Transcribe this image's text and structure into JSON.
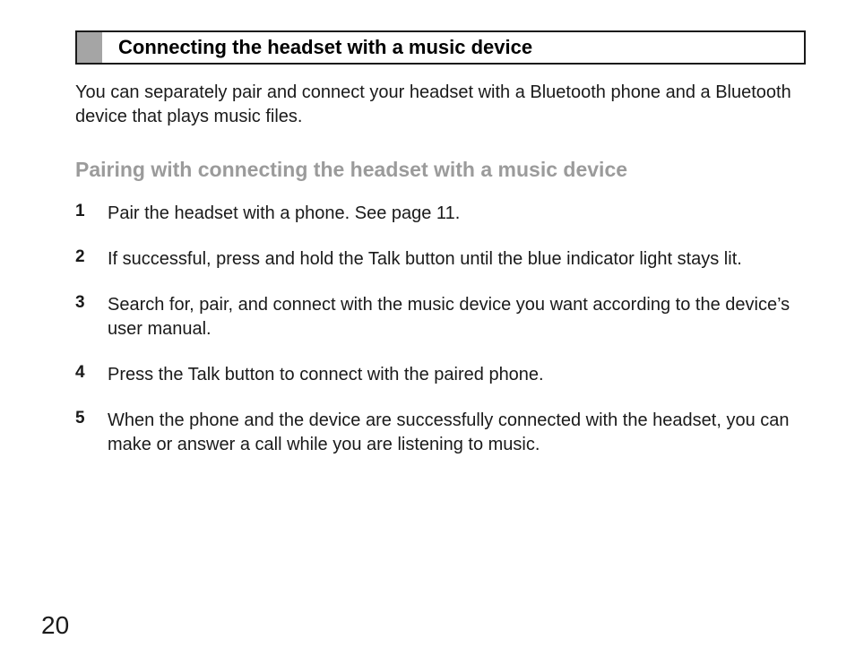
{
  "section": {
    "title": "Connecting the headset with a music device"
  },
  "intro": "You can separately pair and connect your headset with a Bluetooth phone and a Bluetooth device that plays music files.",
  "subheading": "Pairing with connecting the headset with a music device",
  "steps": [
    {
      "num": "1",
      "text": "Pair the headset with a phone. See page 11."
    },
    {
      "num": "2",
      "text": "If successful, press and hold the Talk button until the blue indicator light stays lit."
    },
    {
      "num": "3",
      "text": "Search for, pair, and connect with the music device you want according to the device’s user manual."
    },
    {
      "num": "4",
      "text": "Press the Talk button to connect with the paired phone."
    },
    {
      "num": "5",
      "text": "When the phone and the device are successfully connected with the headset, you can make or answer a call while you are listening to music."
    }
  ],
  "page_number": "20"
}
